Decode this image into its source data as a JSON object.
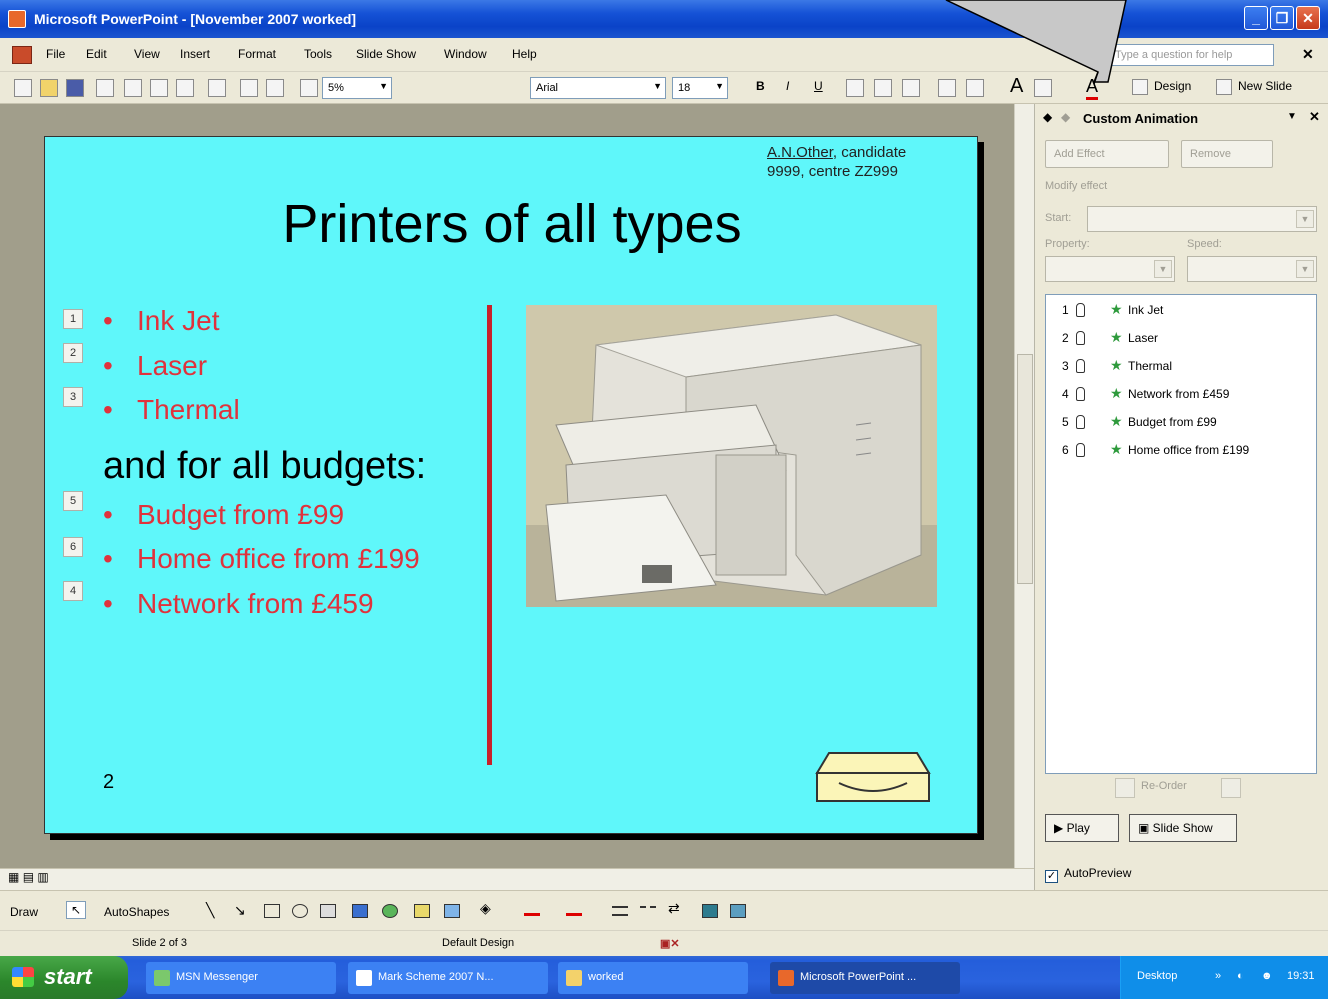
{
  "window": {
    "title": "Microsoft PowerPoint - [November 2007 worked]",
    "controls": [
      "_",
      "❐",
      "✕"
    ]
  },
  "menubar": {
    "items": [
      "File",
      "Edit",
      "View",
      "Insert",
      "Format",
      "Tools",
      "Slide Show",
      "Window",
      "Help"
    ],
    "help_placeholder": "Type a question for help",
    "close": "✕"
  },
  "toolbar": {
    "zoom": "5%",
    "font": "Arial",
    "size": "18",
    "bold": "B",
    "italic": "I",
    "underline": "U",
    "design_label": "Design",
    "new_slide_label": "New Slide"
  },
  "slide": {
    "candidate_name": "A.N.Other",
    "candidate_rest": ", candidate",
    "candidate_line2": "9999, centre ZZ999",
    "title": "Printers of all types",
    "subheading": "and for all budgets:",
    "page_number": "2",
    "group1": [
      {
        "tag": "1",
        "text": "Ink Jet"
      },
      {
        "tag": "2",
        "text": "Laser"
      },
      {
        "tag": "3",
        "text": "Thermal"
      }
    ],
    "group2": [
      {
        "tag": "5",
        "text": "Budget from £99"
      },
      {
        "tag": "6",
        "text": "Home office from £199"
      },
      {
        "tag": "4",
        "text": "Network from £459"
      }
    ],
    "bullet_char": "•"
  },
  "task_pane": {
    "title": "Custom Animation",
    "add_effect": "Add Effect",
    "remove": "Remove",
    "modify_label": "Modify effect",
    "start_label": "Start:",
    "property_label": "Property:",
    "speed_label": "Speed:",
    "animations": [
      {
        "num": "1",
        "label": "Ink Jet"
      },
      {
        "num": "2",
        "label": "Laser"
      },
      {
        "num": "3",
        "label": "Thermal"
      },
      {
        "num": "4",
        "label": "Network from £459"
      },
      {
        "num": "5",
        "label": "Budget from £99"
      },
      {
        "num": "6",
        "label": "Home office from £199"
      }
    ],
    "reorder_label": "Re-Order",
    "play_label": "Play",
    "slideshow_label": "Slide Show",
    "autopreview_label": "AutoPreview",
    "autopreview_checked": true
  },
  "drawbar": {
    "draw": "Draw",
    "autoshapes": "AutoShapes"
  },
  "status": {
    "slide": "Slide 2 of 3",
    "design": "Default Design"
  },
  "taskbar": {
    "start": "start",
    "tasks": [
      "MSN Messenger",
      "Mark Scheme 2007 N...",
      "worked",
      "Microsoft PowerPoint ..."
    ],
    "tray_label": "Desktop",
    "clock": "19:31"
  },
  "colors": {
    "slide_bg": "#5ff7fa",
    "bullet_red": "#e0323c",
    "divider_red": "#c8202a"
  }
}
